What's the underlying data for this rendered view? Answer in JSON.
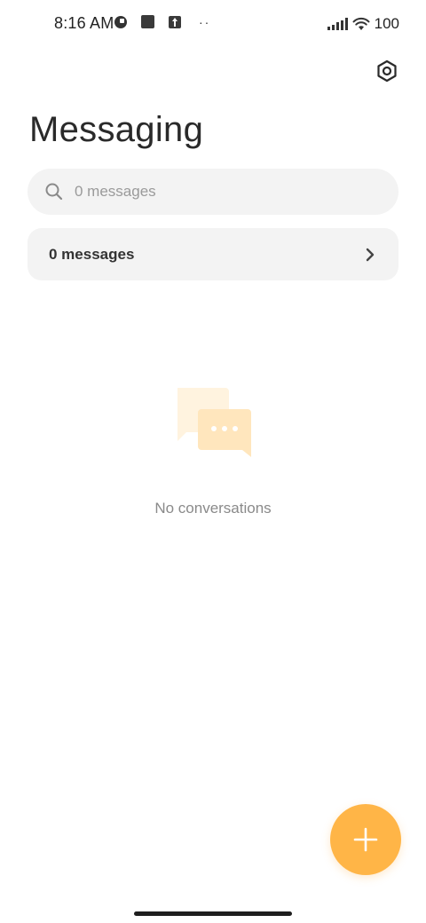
{
  "status_bar": {
    "time": "8:16 AM",
    "dots": "··",
    "battery": "100"
  },
  "header": {
    "title": "Messaging",
    "settings_icon": "gear-icon"
  },
  "search": {
    "placeholder": "0 messages",
    "icon": "search-icon"
  },
  "messages_row": {
    "label": "0 messages",
    "icon": "chevron-right-icon"
  },
  "empty_state": {
    "text": "No conversations",
    "illustration": "chat-bubbles-icon"
  },
  "fab": {
    "icon": "plus-icon"
  },
  "colors": {
    "accent": "#ffb547",
    "surface": "#f3f3f3",
    "illustration_back": "#fff3df",
    "illustration_front": "#ffe6bd"
  }
}
